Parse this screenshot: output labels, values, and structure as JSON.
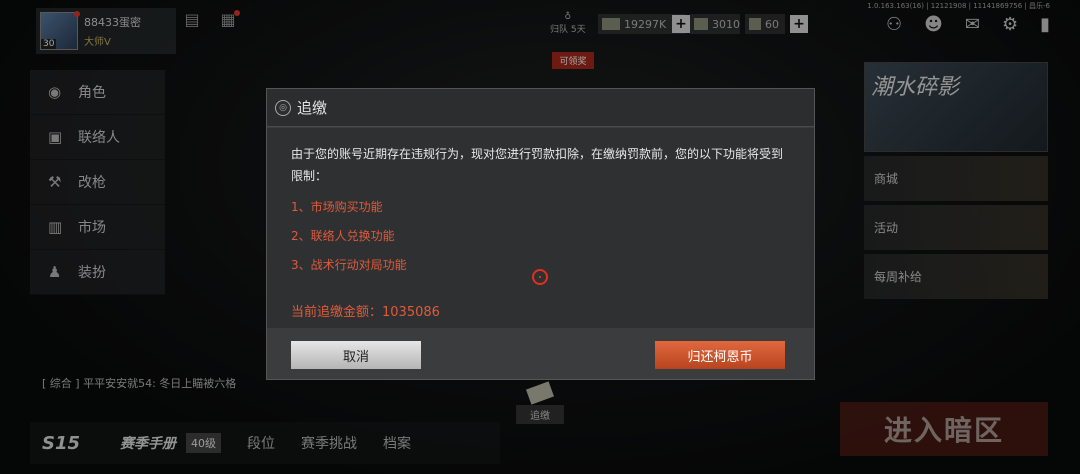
{
  "player": {
    "name": "88433蛋密",
    "level": "30",
    "rank": "大师V"
  },
  "top": {
    "revival_label": "归队 5天",
    "revival_tag": "可领奖",
    "currency1": "19297K",
    "currency2": "3010",
    "currency3": "60",
    "version": "1.0.163.163(16) | 12121908 | 11141869756 | 昌乐-6"
  },
  "left_menu": [
    {
      "label": "角色",
      "icon": "helmet-icon"
    },
    {
      "label": "联络人",
      "icon": "contact-card-icon"
    },
    {
      "label": "改枪",
      "icon": "gun-mod-icon"
    },
    {
      "label": "市场",
      "icon": "market-icon"
    },
    {
      "label": "装扮",
      "icon": "outfit-icon"
    }
  ],
  "right_panel": {
    "banner": "潮水碎影",
    "items": [
      "商城",
      "活动",
      "每周补给"
    ]
  },
  "chat": "[ 综合 ] 平平安安就54: 冬日上瞄被六格",
  "bottom": {
    "season": "S15",
    "pass": "赛季手册",
    "pass_level": "40级",
    "tabs": [
      "段位",
      "赛季挑战",
      "档案"
    ]
  },
  "pay_label": "追缴",
  "enter_label": "进入暗区",
  "modal": {
    "title": "追缴",
    "body": "由于您的账号近期存在违规行为，现对您进行罚款扣除，在缴纳罚款前，您的以下功能将受到限制：",
    "items": [
      "1、市场购买功能",
      "2、联络人兑换功能",
      "3、战术行动对局功能"
    ],
    "amount_label": "当前追缴金额：",
    "amount": "1035086",
    "cancel": "取消",
    "return": "归还柯恩币"
  },
  "colors": {
    "accent": "#e05a3c",
    "button_orange": "#c9532a"
  }
}
